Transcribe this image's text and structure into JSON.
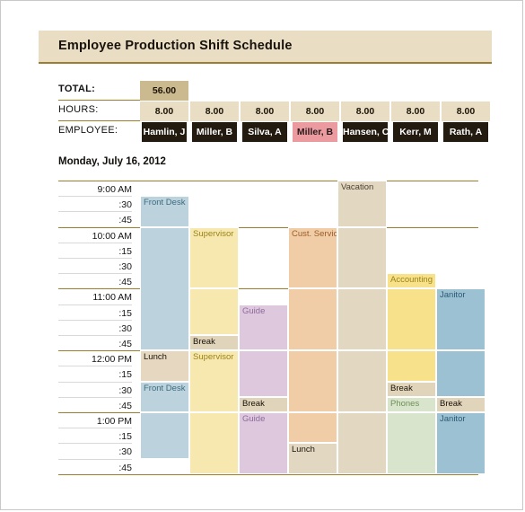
{
  "title": "Employee Production Shift Schedule",
  "summary": {
    "total_label": "TOTAL:",
    "hours_label": "HOURS:",
    "employee_label": "EMPLOYEE:",
    "total_value": "56.00",
    "hours": [
      "8.00",
      "8.00",
      "8.00",
      "8.00",
      "8.00",
      "8.00",
      "8.00"
    ],
    "employees": [
      "Hamlin, J",
      "Miller, B",
      "Silva, A",
      "Miller, B",
      "Hansen, C",
      "Kerr, M",
      "Rath, A"
    ],
    "highlighted_employee_index": 3
  },
  "date": "Monday, July 16, 2012",
  "time_slots": [
    "9:00 AM",
    ":30",
    ":45",
    "10:00 AM",
    ":15",
    ":30",
    ":45",
    "11:00 AM",
    ":15",
    ":30",
    ":45",
    "12:00 PM",
    ":15",
    ":30",
    ":45",
    "1:00 PM",
    ":15",
    ":30",
    ":45"
  ],
  "hour_boundaries": [
    0,
    3,
    7,
    11,
    15,
    19
  ],
  "colors": {
    "banner_bg": "#e9ddc4",
    "banner_rule": "#9c7e2c",
    "total_bg": "#cbb98f",
    "hours_bg": "#e9ddc4",
    "employee_bg": "#231a10",
    "employee_highlight_bg": "#eb9aa0",
    "front_desk": "#bcd3dd",
    "supervisor": "#f7e8b0",
    "guide": "#ddc8de",
    "cust_service": "#f0cda7",
    "vacation": "#e2d8c2",
    "accounting": "#f7e28b",
    "janitor": "#9cc1d3",
    "phones": "#d8e4cc",
    "break": "#e0d4bb",
    "lunch": "#e2d8c2",
    "lunch_col1": "#e6d8c0"
  },
  "shifts": [
    {
      "column": 0,
      "task": "Front Desk",
      "start": 1,
      "end": 3,
      "fill": "#bcd3dd",
      "text": "#3d6b80"
    },
    {
      "column": 0,
      "task": "",
      "start": 3,
      "end": 11,
      "fill": "#bcd3dd",
      "text": "#3d6b80"
    },
    {
      "column": 0,
      "task": "Lunch",
      "start": 11,
      "end": 13,
      "fill": "#e6d8c0",
      "text": "#1a1308"
    },
    {
      "column": 0,
      "task": "Front Desk",
      "start": 13,
      "end": 15,
      "fill": "#bcd3dd",
      "text": "#3d6b80"
    },
    {
      "column": 0,
      "task": "",
      "start": 15,
      "end": 18,
      "fill": "#bcd3dd",
      "text": "#3d6b80"
    },
    {
      "column": 1,
      "task": "Supervisor",
      "start": 3,
      "end": 7,
      "fill": "#f7e8b0",
      "text": "#9c8417"
    },
    {
      "column": 1,
      "task": "",
      "start": 7,
      "end": 10,
      "fill": "#f7e8b0",
      "text": "#9c8417"
    },
    {
      "column": 1,
      "task": "Break",
      "start": 10,
      "end": 11,
      "fill": "#e0d4bb",
      "text": "#1a1308"
    },
    {
      "column": 1,
      "task": "Supervisor",
      "start": 11,
      "end": 15,
      "fill": "#f7e8b0",
      "text": "#9c8417"
    },
    {
      "column": 1,
      "task": "",
      "start": 15,
      "end": 19,
      "fill": "#f7e8b0",
      "text": "#9c8417"
    },
    {
      "column": 2,
      "task": "Guide",
      "start": 8,
      "end": 11,
      "fill": "#ddc8de",
      "text": "#8e6b9b"
    },
    {
      "column": 2,
      "task": "",
      "start": 11,
      "end": 14,
      "fill": "#ddc8de",
      "text": "#8e6b9b"
    },
    {
      "column": 2,
      "task": "Break",
      "start": 14,
      "end": 15,
      "fill": "#e0d4bb",
      "text": "#1a1308"
    },
    {
      "column": 2,
      "task": "Guide",
      "start": 15,
      "end": 19,
      "fill": "#ddc8de",
      "text": "#8e6b9b"
    },
    {
      "column": 3,
      "task": "Cust. Service",
      "start": 3,
      "end": 7,
      "fill": "#f0cda7",
      "text": "#9a5d28"
    },
    {
      "column": 3,
      "task": "",
      "start": 7,
      "end": 11,
      "fill": "#f0cda7",
      "text": "#9a5d28"
    },
    {
      "column": 3,
      "task": "",
      "start": 11,
      "end": 15,
      "fill": "#f0cda7",
      "text": "#9a5d28"
    },
    {
      "column": 3,
      "task": "",
      "start": 15,
      "end": 17,
      "fill": "#f0cda7",
      "text": "#9a5d28"
    },
    {
      "column": 3,
      "task": "Lunch",
      "start": 17,
      "end": 19,
      "fill": "#e2d8c2",
      "text": "#1a1308"
    },
    {
      "column": 4,
      "task": "Vacation",
      "start": 0,
      "end": 3,
      "fill": "#e2d8c2",
      "text": "#4d4032"
    },
    {
      "column": 4,
      "task": "",
      "start": 3,
      "end": 7,
      "fill": "#e2d8c2",
      "text": "#4d4032"
    },
    {
      "column": 4,
      "task": "",
      "start": 7,
      "end": 11,
      "fill": "#e2d8c2",
      "text": "#4d4032"
    },
    {
      "column": 4,
      "task": "",
      "start": 11,
      "end": 15,
      "fill": "#e2d8c2",
      "text": "#4d4032"
    },
    {
      "column": 4,
      "task": "",
      "start": 15,
      "end": 19,
      "fill": "#e2d8c2",
      "text": "#4d4032"
    },
    {
      "column": 5,
      "task": "Accounting",
      "start": 6,
      "end": 7,
      "fill": "#f7e28b",
      "text": "#9c8417"
    },
    {
      "column": 5,
      "task": "",
      "start": 7,
      "end": 11,
      "fill": "#f7e28b",
      "text": "#9c8417"
    },
    {
      "column": 5,
      "task": "",
      "start": 11,
      "end": 13,
      "fill": "#f7e28b",
      "text": "#9c8417"
    },
    {
      "column": 5,
      "task": "Break",
      "start": 13,
      "end": 14,
      "fill": "#e0d4bb",
      "text": "#1a1308"
    },
    {
      "column": 5,
      "task": "Phones",
      "start": 14,
      "end": 15,
      "fill": "#d8e4cc",
      "text": "#6d9155"
    },
    {
      "column": 5,
      "task": "",
      "start": 15,
      "end": 19,
      "fill": "#d8e4cc",
      "text": "#6d9155"
    },
    {
      "column": 6,
      "task": "Janitor",
      "start": 7,
      "end": 11,
      "fill": "#9cc1d3",
      "text": "#2c5a74"
    },
    {
      "column": 6,
      "task": "",
      "start": 11,
      "end": 14,
      "fill": "#9cc1d3",
      "text": "#2c5a74"
    },
    {
      "column": 6,
      "task": "Break",
      "start": 14,
      "end": 15,
      "fill": "#e0d4bb",
      "text": "#1a1308"
    },
    {
      "column": 6,
      "task": "Janitor",
      "start": 15,
      "end": 19,
      "fill": "#9cc1d3",
      "text": "#2c5a74"
    }
  ]
}
